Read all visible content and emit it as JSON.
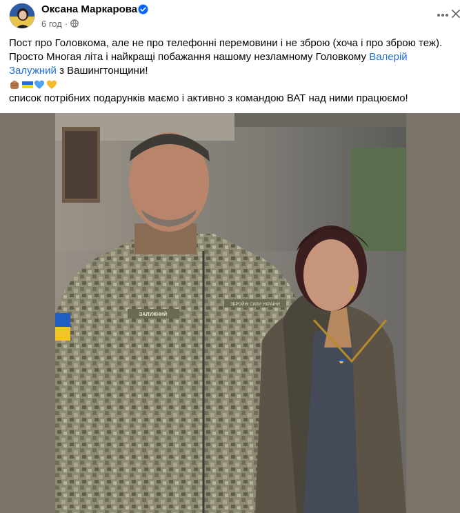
{
  "post": {
    "author": "Оксана Маркарова",
    "time": "6 год",
    "line1": "Пост про Головкома, але не про телефонні перемовини і не зброю (хоча і про зброю теж).",
    "line2": "Просто Многая літа і найкращі побажання нашому незламному Головкому ",
    "mention_part1": "Валерій",
    "mention_part2": "Залужний",
    "line3_rest": " з Вашингтонщини!",
    "line4": "список потрібних подарунків маємо і активно з командою ВАТ над ними працюємо!"
  },
  "photo": {
    "patch_left": "ЗАЛУЖНИЙ",
    "patch_right": "ЗБРОЙНІ СИЛИ УКРАЇНИ"
  },
  "colors": {
    "mention": "#216fdb",
    "verified": "#0866ff",
    "meta": "#65676b"
  }
}
